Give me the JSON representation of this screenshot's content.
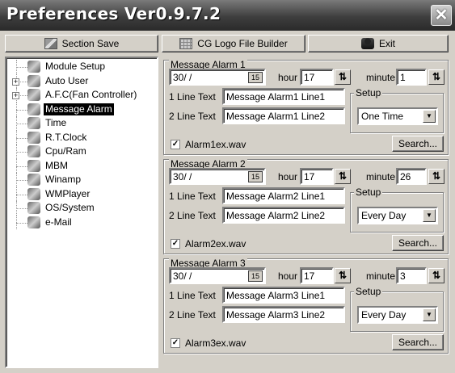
{
  "window": {
    "title": "Preferences Ver0.9.7.2",
    "close_glyph": "✕"
  },
  "toolbar": {
    "section_save": "Section Save",
    "logo_builder": "CG Logo File Builder",
    "exit": "Exit"
  },
  "sidebar": {
    "items": [
      {
        "label": "Module Setup",
        "icon": "module-icon",
        "expandable": false
      },
      {
        "label": "Auto User",
        "icon": "user-icon",
        "expandable": true
      },
      {
        "label": "A.F.C(Fan Controller)",
        "icon": "fan-icon",
        "expandable": true
      },
      {
        "label": "Message Alarm",
        "icon": "alarm-icon",
        "expandable": false,
        "selected": true
      },
      {
        "label": "Time",
        "icon": "time-icon",
        "expandable": false
      },
      {
        "label": "R.T.Clock",
        "icon": "clock-icon",
        "expandable": false
      },
      {
        "label": "Cpu/Ram",
        "icon": "cpu-icon",
        "expandable": false
      },
      {
        "label": "MBM",
        "icon": "mbm-icon",
        "expandable": false
      },
      {
        "label": "Winamp",
        "icon": "winamp-icon",
        "expandable": false
      },
      {
        "label": "WMPlayer",
        "icon": "wmplayer-icon",
        "expandable": false
      },
      {
        "label": "OS/System",
        "icon": "system-icon",
        "expandable": false
      },
      {
        "label": "e-Mail",
        "icon": "mail-icon",
        "expandable": false
      }
    ]
  },
  "labels": {
    "hour": "hour",
    "minute": "minute",
    "line1": "1 Line Text",
    "line2": "2 Line Text",
    "setup": "Setup",
    "search": "Search...",
    "date_icon": "15"
  },
  "alarms": [
    {
      "title": "Message Alarm 1",
      "date": "30/ /",
      "hour": "17",
      "minute": "1",
      "line1": "Message Alarm1 Line1",
      "line2": "Message Alarm1 Line2",
      "setup": "One Time",
      "checked": true,
      "wav": "Alarm1ex.wav"
    },
    {
      "title": "Message Alarm 2",
      "date": "30/ /",
      "hour": "17",
      "minute": "26",
      "line1": "Message Alarm2 Line1",
      "line2": "Message Alarm2 Line2",
      "setup": "Every Day",
      "checked": true,
      "wav": "Alarm2ex.wav"
    },
    {
      "title": "Message Alarm 3",
      "date": "30/ /",
      "hour": "17",
      "minute": "3",
      "line1": "Message Alarm3 Line1",
      "line2": "Message Alarm3 Line2",
      "setup": "Every Day",
      "checked": true,
      "wav": "Alarm3ex.wav"
    }
  ]
}
